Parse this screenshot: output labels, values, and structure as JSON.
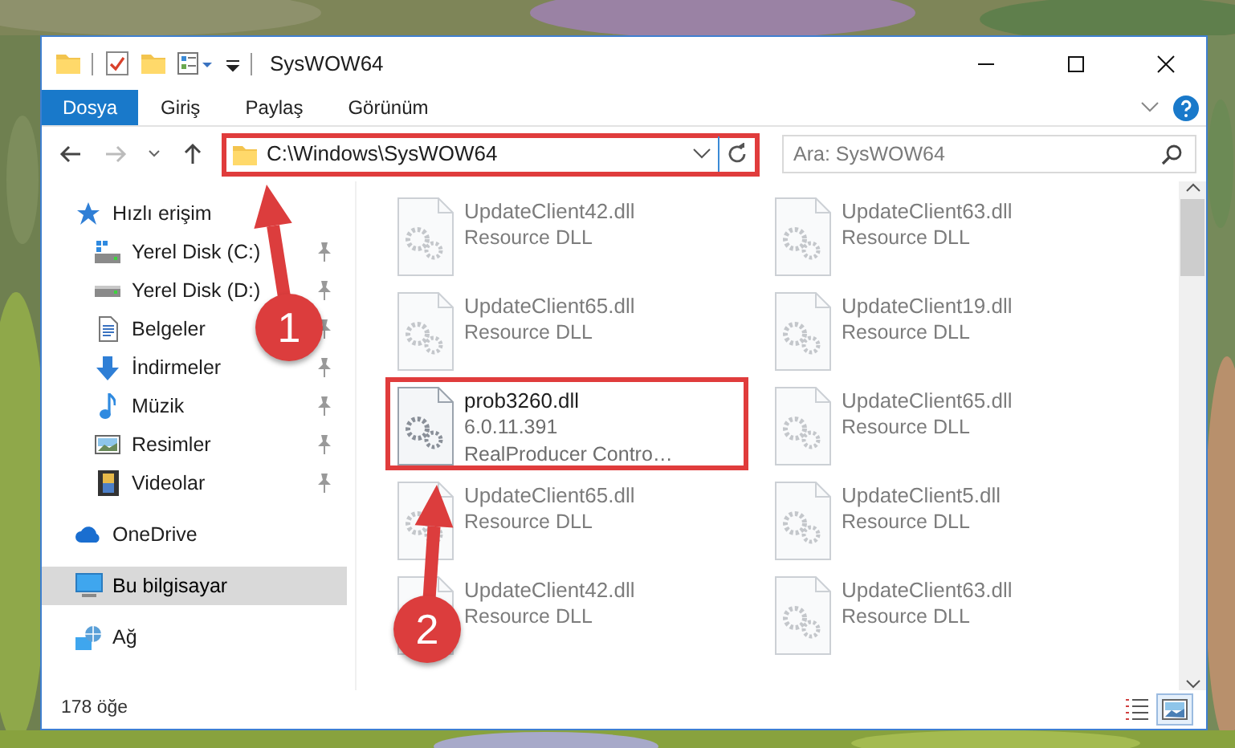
{
  "window": {
    "title": "SysWOW64"
  },
  "ribbon_tabs": [
    {
      "label": "Dosya",
      "selected": true
    },
    {
      "label": "Giriş",
      "selected": false
    },
    {
      "label": "Paylaş",
      "selected": false
    },
    {
      "label": "Görünüm",
      "selected": false
    }
  ],
  "address": {
    "path": "C:\\Windows\\SysWOW64",
    "highlighted": true
  },
  "search": {
    "placeholder": "Ara: SysWOW64"
  },
  "nav_pane": {
    "items": [
      {
        "label": "Hızlı erişim",
        "kind": "star",
        "selected": false,
        "children": [
          {
            "label": "Yerel Disk (C:)",
            "kind": "systemdrive",
            "pinned": true,
            "selected": false
          },
          {
            "label": "Yerel Disk (D:)",
            "kind": "drive",
            "pinned": true,
            "selected": false
          },
          {
            "label": "Belgeler",
            "kind": "documents",
            "pinned": true,
            "selected": false
          },
          {
            "label": "İndirmeler",
            "kind": "downloads",
            "pinned": true,
            "selected": false
          },
          {
            "label": "Müzik",
            "kind": "music",
            "pinned": true,
            "selected": false
          },
          {
            "label": "Resimler",
            "kind": "pictures",
            "pinned": true,
            "selected": false
          },
          {
            "label": "Videolar",
            "kind": "videos",
            "pinned": true,
            "selected": false
          }
        ]
      },
      {
        "label": "OneDrive",
        "kind": "cloud",
        "selected": false
      },
      {
        "label": "Bu bilgisayar",
        "kind": "computer",
        "selected": true
      },
      {
        "label": "Ağ",
        "kind": "network",
        "selected": false
      }
    ]
  },
  "files": [
    {
      "name": "UpdateClient42.dll",
      "details": [
        "Resource DLL"
      ],
      "dimmed": true,
      "highlighted": false
    },
    {
      "name": "UpdateClient63.dll",
      "details": [
        "Resource DLL"
      ],
      "dimmed": true,
      "highlighted": false
    },
    {
      "name": "UpdateClient65.dll",
      "details": [
        "Resource DLL"
      ],
      "dimmed": true,
      "highlighted": false
    },
    {
      "name": "UpdateClient19.dll",
      "details": [
        "Resource DLL"
      ],
      "dimmed": true,
      "highlighted": false
    },
    {
      "name": "prob3260.dll",
      "details": [
        "6.0.11.391",
        "RealProducer Contro…"
      ],
      "dimmed": false,
      "highlighted": true
    },
    {
      "name": "UpdateClient65.dll",
      "details": [
        "Resource DLL"
      ],
      "dimmed": true,
      "highlighted": false
    },
    {
      "name": "UpdateClient65.dll",
      "details": [
        "Resource DLL"
      ],
      "dimmed": true,
      "highlighted": false
    },
    {
      "name": "UpdateClient5.dll",
      "details": [
        "Resource DLL"
      ],
      "dimmed": true,
      "highlighted": false
    },
    {
      "name": "UpdateClient42.dll",
      "details": [
        "Resource DLL"
      ],
      "dimmed": true,
      "highlighted": false
    },
    {
      "name": "UpdateClient63.dll",
      "details": [
        "Resource DLL"
      ],
      "dimmed": true,
      "highlighted": false
    }
  ],
  "status_bar": {
    "item_count": "178 öğe",
    "view_buttons": [
      {
        "kind": "details",
        "selected": false
      },
      {
        "kind": "large_icons",
        "selected": true
      }
    ]
  },
  "callouts": [
    {
      "label": "1"
    },
    {
      "label": "2"
    }
  ]
}
